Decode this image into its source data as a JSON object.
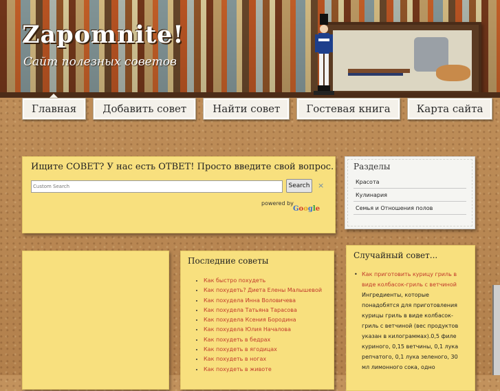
{
  "header": {
    "logo": "Zapomnite!",
    "tagline": "Сайт полезных советов"
  },
  "nav": {
    "items": [
      "Главная",
      "Добавить совет",
      "Найти совет",
      "Гостевая книга",
      "Карта сайта"
    ]
  },
  "search": {
    "title": "Ищите СОВЕТ? У нас есть ОТВЕТ! Просто введите свой вопрос.",
    "placeholder": "Custom Search",
    "button_label": "Search",
    "clear_symbol": "×",
    "powered_by": "powered by",
    "google": "Google"
  },
  "sections": {
    "title": "Разделы",
    "items": [
      "Красота",
      "Кулинария",
      "Семья и Отношения полов"
    ]
  },
  "latest": {
    "title": "Последние советы",
    "items": [
      "Как быстро похудеть",
      "Как похудеть? Диета Елены Малышевой",
      "Как похудела Инна Воловичева",
      "Как похудела Татьяна Тарасова",
      "Как похудела Ксения Бородина",
      "Как похудела Юлия Началова",
      "Как похудеть в бедрах",
      "Как похудеть в ягодицах",
      "Как похудеть в ногах",
      "Как похудеть в животе"
    ]
  },
  "random": {
    "title": "Случайный совет...",
    "link": "Как приготовить курицу гриль в виде колбасок-гриль с ветчиной",
    "text": "Ингредиенты, которые понадобятся для приготовления курицы гриль в виде колбасок-гриль с ветчиной (вес продуктов указан в килограммах).0,5 филе куриного, 0,15 ветчины, 0,1 лука репчатого, 0,1 лука зеленого, 30 мл лимонного сока, одно"
  },
  "colors": {
    "note": "#f8e07e",
    "link": "#c0392b",
    "shelf": "#4c2c18"
  }
}
